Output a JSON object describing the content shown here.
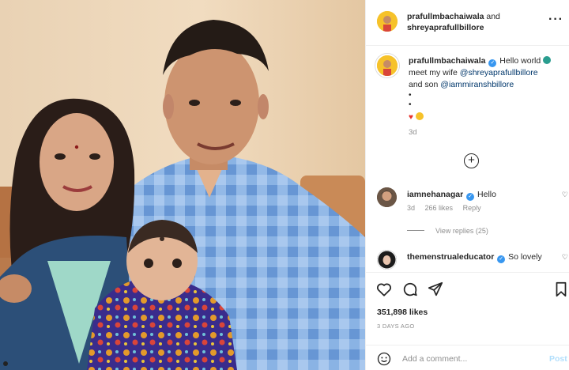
{
  "header": {
    "user1": "prafullmbachaiwala",
    "and": "and",
    "user2": "shreyaprafullbillore",
    "more_icon": "more-icon"
  },
  "caption": {
    "username": "prafullmbachaiwala",
    "line1": "Hello world",
    "line2": "meet my wife",
    "mention1": "@shreyaprafullbillore",
    "line3": "and son",
    "mention2": "@iammiranshbillore",
    "dot": "•",
    "age": "3d"
  },
  "comments": [
    {
      "username": "iamnehanagar",
      "text": "Hello",
      "age": "3d",
      "likes": "266 likes",
      "reply": "Reply",
      "view_replies": "View replies (25)",
      "avatar_color": "#5b4a3c"
    },
    {
      "username": "themenstrualeducator",
      "text": "So lovely",
      "avatar_color": "#1c1c1c"
    }
  ],
  "actions": {
    "likes": "351,898 likes",
    "time_ago": "3 DAYS AGO"
  },
  "add_comment": {
    "placeholder": "Add a comment...",
    "post": "Post"
  },
  "colors": {
    "verified": "#3897f0",
    "mention": "#00376b",
    "muted": "#8e8e8e",
    "post_disabled": "#b2dffc"
  }
}
